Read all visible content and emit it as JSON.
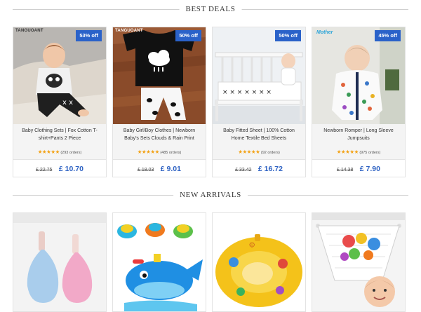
{
  "sections": {
    "best_deals": "BEST DEALS",
    "new_arrivals": "NEW ARRIVALS"
  },
  "deals": [
    {
      "brand": "TANGUOANT",
      "discount": "53% off",
      "title": "Baby Clothing Sets | Fox Cotton T-shirt+Pants 2 Piece",
      "stars": "★★★★★",
      "orders": "(293 orders)",
      "old_price": "£ 22.75",
      "new_price": "£ 10.70"
    },
    {
      "brand": "TANGUOANT",
      "discount": "50% off",
      "title": "Baby Girl/Boy Clothes | Newborn Baby's Sets Clouds & Rain Print",
      "stars": "★★★★★",
      "orders": "(485 orders)",
      "old_price": "£ 18.03",
      "new_price": "£ 9.01"
    },
    {
      "discount": "50% off",
      "title": "Baby Fitted Sheet | 100% Cotton Home Textile Bed Sheets",
      "stars": "★★★★★",
      "orders": "(92 orders)",
      "old_price": "£ 33.42",
      "new_price": "£ 16.72"
    },
    {
      "brand": "Mother",
      "discount": "45% off",
      "title": "Newborn Romper | Long Sleeve Jumpsuits",
      "stars": "★★★★★",
      "orders": "(975 orders)",
      "old_price": "£ 14.38",
      "new_price": "£ 7.90"
    }
  ],
  "colors": {
    "badge": "#2a62c9",
    "price": "#2f63c3",
    "stars": "#f3a214"
  }
}
